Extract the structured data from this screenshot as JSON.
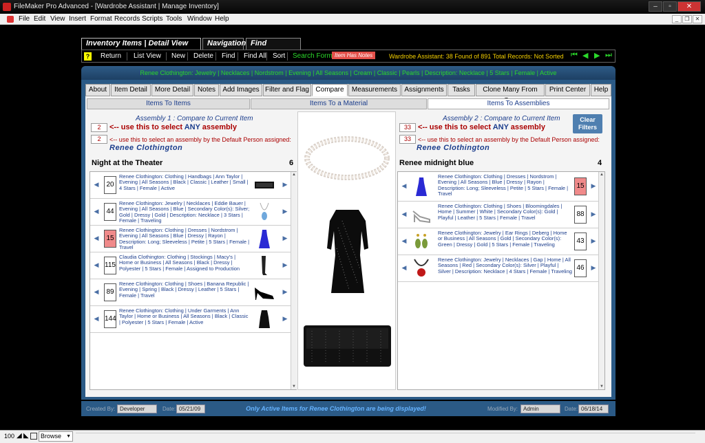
{
  "window": {
    "title": "FileMaker Pro Advanced - [Wardrobe Assistant | Manage Inventory]"
  },
  "menu": [
    "File",
    "Edit",
    "View",
    "Insert",
    "Format",
    "Records",
    "Scripts",
    "Tools",
    "Window",
    "Help"
  ],
  "top_tabs": [
    "Inventory Items | Detail View Toolbar",
    "Navigation",
    "Find Functions"
  ],
  "toolbar": {
    "help": "?",
    "buttons": [
      "Return",
      "List View",
      "New",
      "Delete",
      "Find",
      "Find All",
      "Sort"
    ],
    "search_form": "Search Form",
    "item_has_notes": "Item Has Notes",
    "status": "Wardrobe Assistant: 38 Found of 891 Total Records: Not Sorted"
  },
  "banner": "Renee Clothington: Jewelry | Necklaces | Nordstrom | Evening | All Seasons | Cream | Classic | Pearls | Description: Necklace | 5 Stars | Female | Active",
  "main_tabs": [
    "About",
    "Item Detail",
    "More Detail",
    "Notes",
    "Add Images",
    "Filter and Flag",
    "Compare",
    "Measurements",
    "Assignments",
    "Tasks",
    "Clone Many From One",
    "Print Center",
    "Help"
  ],
  "sub_tabs": [
    "Items To Items",
    "Items To a Material",
    "Items To Assemblies"
  ],
  "assembly1": {
    "header": "Assembly 1 : Compare to Current Item",
    "any_num": "2",
    "any_label_pre": "<-- use this to select ",
    "any_word": "ANY",
    "any_label_post": " assembly",
    "person_num": "2",
    "person_label": "<-- use this to select an assembly by the Default Person assigned:",
    "person": "Renee Clothington",
    "name": "Night at the Theater",
    "count": "6",
    "rows": [
      {
        "num": "20",
        "desc": "Renee Clothington: Clothing | Handbags | Ann Taylor | Evening | All Seasons | Black | Classic | Leather | Small | 4 Stars | Female | Active"
      },
      {
        "num": "44",
        "desc": "Renee Clothington: Jewelry | Necklaces | Eddie Bauer | Evening | All Seasons | Blue | Secondary Color(s): Silver; Gold | Dressy | Gold | Description: Necklace | 3 Stars | Female | Traveling"
      },
      {
        "num": "15",
        "desc": "Renee Clothington: Clothing | Dresses | Nordstrom | Evening | All Seasons | Blue | Dressy | Rayon | Description: Long; Sleeveless | Petite | 5 Stars | Female | Travel"
      },
      {
        "num": "115",
        "desc": "Claudia Clothington: Clothing | Stockings | Macy's | Home or Business | All Seasons | Black | Dressy | Polyester | 5 Stars | Female | Assigned to Production"
      },
      {
        "num": "89",
        "desc": "Renee Clothington: Clothing | Shoes | Banana Republic | Evening | Spring | Black | Dressy | Leather | 5 Stars | Female | Travel"
      },
      {
        "num": "144",
        "desc": "Renee Clothington: Clothing | Under Garments | Ann Taylor | Home or Business | All Seasons | Black | Classic | Polyester | 5 Stars | Female | Active"
      }
    ]
  },
  "assembly2": {
    "header": "Assembly 2 : Compare to Current Item",
    "any_num": "33",
    "any_label_pre": "<-- use this to select ",
    "any_word": "ANY",
    "any_label_post": " assembly",
    "person_num": "33",
    "person_label": "<-- use this to select an assembly by the Default Person assigned:",
    "person": "Renee Clothington",
    "name": "Renee midnight blue",
    "count": "4",
    "rows": [
      {
        "num": "15",
        "desc": "Renee Clothington: Clothing | Dresses | Nordstrom | Evening | All Seasons | Blue | Dressy | Rayon | Description: Long; Sleeveless | Petite | 5 Stars | Female | Travel"
      },
      {
        "num": "88",
        "desc": "Renee Clothington: Clothing | Shoes | Bloomingdales | Home | Summer | White | Secondary Color(s): Gold | Playful | Leather | 5 Stars | Female | Travel"
      },
      {
        "num": "43",
        "desc": "Renee Clothington: Jewelry | Ear Rings | Deberg | Home or Business | All Seasons | Gold | Secondary Color(s): Green | Dressy | Gold | 5 Stars | Female | Traveling"
      },
      {
        "num": "46",
        "desc": "Renee Clothington: Jewelry | Necklaces | Gap | Home | All Seasons | Red | Secondary Color(s): Silver | Playful | Silver | Description: Necklace | 4 Stars | Female | Traveling"
      }
    ]
  },
  "clear_filters": "Clear Filters",
  "footer": {
    "created_by_label": "Created By:",
    "created_by": "Developer",
    "date_label": "Date:",
    "created_date": "05/21/09",
    "message": "Only Active Items for Renee Clothington are being displayed!",
    "modified_by_label": "Modified By:",
    "modified_by": "Admin",
    "modified_date": "06/18/14"
  },
  "status_bar": {
    "zoom": "100",
    "mode": "Browse"
  }
}
